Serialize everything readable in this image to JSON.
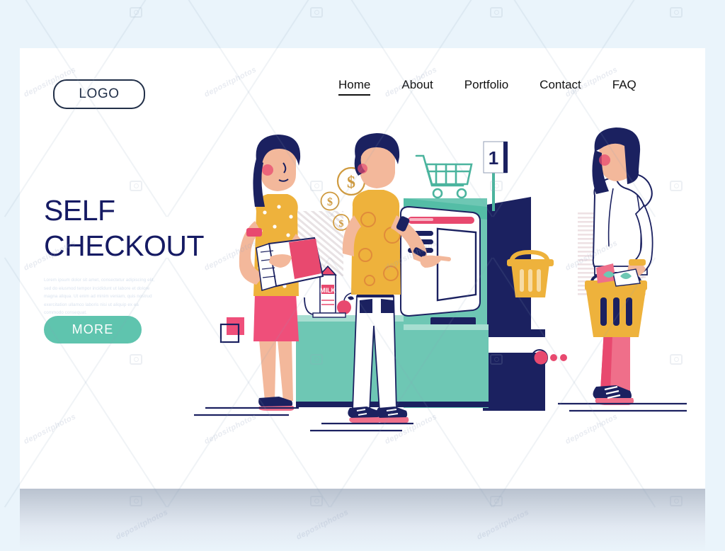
{
  "page": {
    "background_color": "#eaf4fb",
    "card_color": "#ffffff"
  },
  "header": {
    "logo_label": "LOGO",
    "nav": [
      {
        "label": "Home",
        "active": true
      },
      {
        "label": "About",
        "active": false
      },
      {
        "label": "Portfolio",
        "active": false
      },
      {
        "label": "Contact",
        "active": false
      },
      {
        "label": "FAQ",
        "active": false
      }
    ]
  },
  "hero": {
    "headline_line1": "SELF",
    "headline_line2": "CHECKOUT",
    "headline_color": "#151a63",
    "body_text": "Lorem ipsum dolor sit amet, consectetur adipiscing elit, sed do eiusmod tempor incididunt ut labore et dolore magna aliqua. Ut enim ad minim veniam, quis nostrud exercitation ullamco laboris nisi ut aliquip ex ea commodo consequat.",
    "cta_label": "MORE",
    "cta_color": "#5fc4ae",
    "cta_text_color": "#ffffff"
  },
  "illustration": {
    "scene_name": "self-checkout-store-scene",
    "kiosk_number_sign": "1",
    "product_label": "MILK",
    "coin_symbols": [
      "$",
      "$",
      "$"
    ],
    "colors": {
      "navy": "#1b2160",
      "teal": "#6ec7b4",
      "teal_dark": "#4bb49e",
      "yellow": "#eeb23c",
      "mustard": "#e5a93a",
      "pink": "#e8496f",
      "coral": "#ef6f8a",
      "skin": "#f3b89b",
      "white": "#ffffff",
      "gold": "#cf9a3e"
    },
    "elements": [
      "woman-with-box",
      "dollar-coins",
      "man-at-kiosk",
      "shopping-cart-icon",
      "kiosk-screen",
      "receipt",
      "milk-carton",
      "apple",
      "counter",
      "shopping-basket-on-counter",
      "woman-with-basket",
      "decorative-squares"
    ]
  },
  "watermark": {
    "text": "depositphotos"
  }
}
